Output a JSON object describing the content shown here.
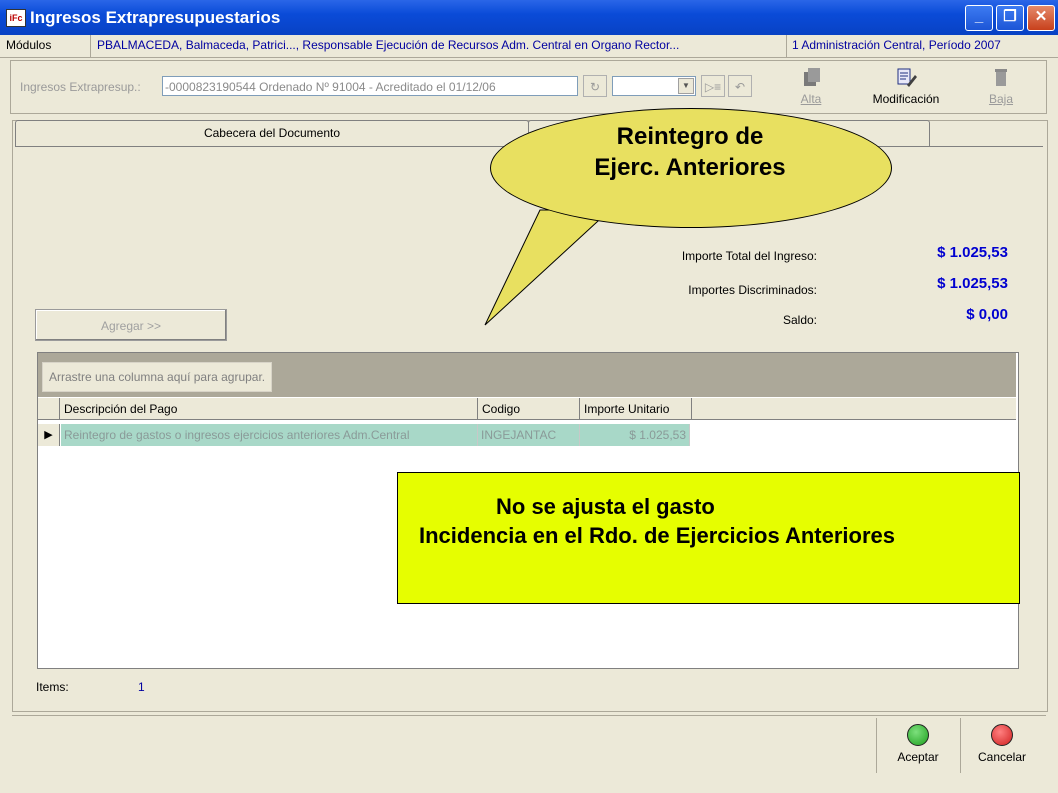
{
  "window": {
    "title": "Ingresos Extrapresupuestarios",
    "icon_text": "iFc",
    "minimize": "_",
    "maximize": "❐",
    "close": "✕"
  },
  "modbar": {
    "label": "Módulos",
    "user": "PBALMACEDA, Balmaceda, Patrici..., Responsable Ejecución de Recursos Adm. Central en Organo Rector...",
    "context": "1 Administración Central, Período 2007"
  },
  "doc": {
    "label": "Ingresos Extrapresup.:",
    "value": "-0000823190544 Ordenado Nº 91004 - Acreditado el  01/12/06",
    "combo_value": ""
  },
  "toolbar": {
    "alta": "Alta",
    "modificacion": "Modificación",
    "baja": "Baja"
  },
  "tabs": {
    "tab1": "Cabecera del Documento",
    "tab2": ""
  },
  "summary": {
    "total_label": "Importe Total del Ingreso:",
    "total_value": "$ 1.025,53",
    "disc_label": "Importes Discriminados:",
    "disc_value": "$ 1.025,53",
    "saldo_label": "Saldo:",
    "saldo_value": "$ 0,00"
  },
  "add_button": "Agregar   >>",
  "grid": {
    "group_hint": "Arrastre una columna aquí para agrupar.",
    "columns": [
      "Descripción del Pago",
      "Codigo",
      "Importe Unitario"
    ],
    "rows": [
      [
        "Reintegro de gastos  o ingresos ejercicios anteriores Adm.Central",
        "INGEJANTAC",
        "$ 1.025,53"
      ]
    ]
  },
  "callout": {
    "line1": "Reintegro de",
    "line2": "Ejerc. Anteriores"
  },
  "note": {
    "line1": "No se ajusta el gasto",
    "line2": "Incidencia en el Rdo. de Ejercicios Anteriores"
  },
  "footer": {
    "items_label": "Items:",
    "items_value": "1",
    "accept": "Aceptar",
    "cancel": "Cancelar"
  },
  "colors": {
    "accent_blue": "#0000d0",
    "note_bg": "#e6fe00",
    "callout_bg": "#e8e060",
    "accept": "#1ea01e",
    "cancel": "#d02020"
  }
}
